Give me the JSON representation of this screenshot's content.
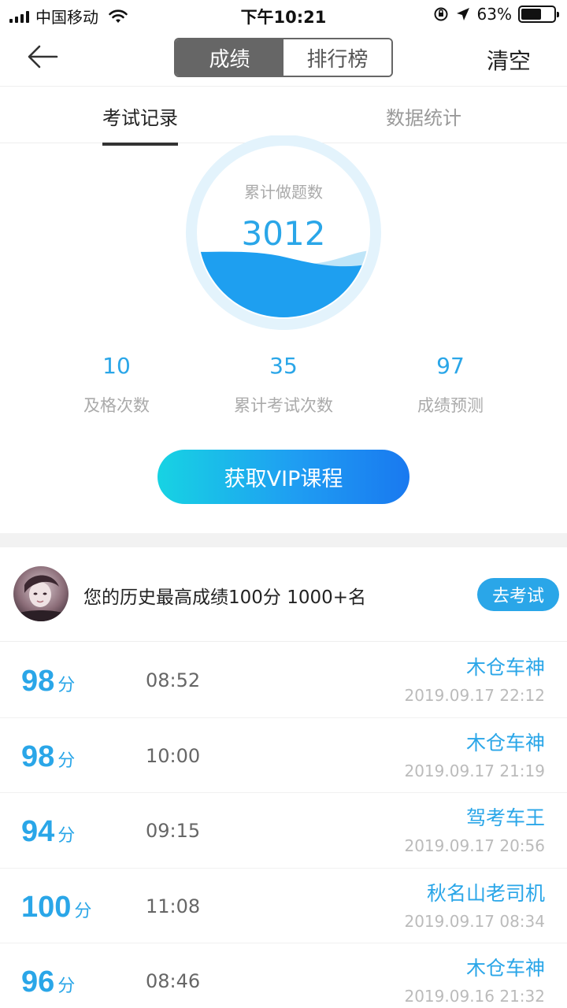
{
  "status_bar": {
    "carrier": "中国移动",
    "time": "下午10:21",
    "battery_percent": "63%",
    "battery_level": 0.63,
    "icons": [
      "signal-icon",
      "wifi-icon",
      "orientation-lock-icon",
      "location-icon",
      "battery-icon"
    ]
  },
  "nav": {
    "back_icon": "back-arrow-icon",
    "segments": [
      "成绩",
      "排行榜"
    ],
    "active_segment": "成绩",
    "clear_label": "清空"
  },
  "tabs": {
    "records": "考试记录",
    "stats": "数据统计",
    "active": "考试记录"
  },
  "summary": {
    "circle_label": "累计做题数",
    "circle_value": "3012",
    "stats": [
      {
        "value": "10",
        "label": "及格次数"
      },
      {
        "value": "35",
        "label": "累计考试次数"
      },
      {
        "value": "97",
        "label": "成绩预测"
      }
    ],
    "vip_button": "获取VIP课程"
  },
  "best": {
    "text": "您的历史最高成绩100分  1000+名",
    "go_button": "去考试"
  },
  "records": [
    {
      "score": "98",
      "unit": "分",
      "duration": "08:52",
      "name": "木仓车神",
      "date": "2019.09.17 22:12"
    },
    {
      "score": "98",
      "unit": "分",
      "duration": "10:00",
      "name": "木仓车神",
      "date": "2019.09.17 21:19"
    },
    {
      "score": "94",
      "unit": "分",
      "duration": "09:15",
      "name": "驾考车王",
      "date": "2019.09.17 20:56"
    },
    {
      "score": "100",
      "unit": "分",
      "duration": "11:08",
      "name": "秋名山老司机",
      "date": "2019.09.17 08:34"
    },
    {
      "score": "96",
      "unit": "分",
      "duration": "08:46",
      "name": "木仓车神",
      "date": "2019.09.16 21:32"
    }
  ],
  "colors": {
    "accent": "#2aa6e8",
    "wave_dark": "#1e9ff0",
    "wave_light": "#bfe5f8",
    "segment_active": "#666666"
  }
}
